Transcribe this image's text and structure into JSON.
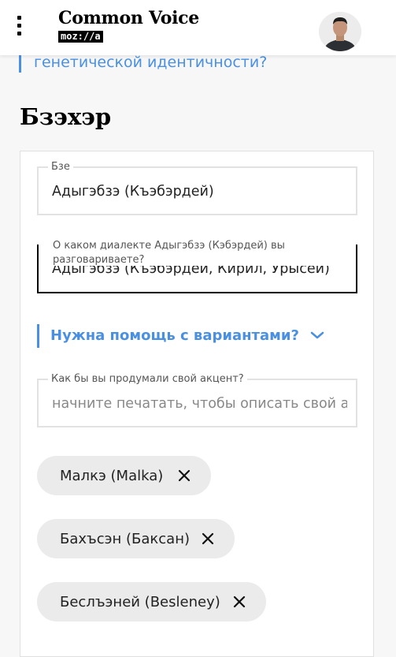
{
  "header": {
    "brand_title": "Common Voice",
    "brand_sub": "moz://a",
    "icons": {
      "menu": "menu-icon",
      "avatar": "user-avatar"
    }
  },
  "previous_field_text": "генетической идентичности?",
  "section_title": "Бзэхэр",
  "language_field": {
    "label": "Бзе",
    "value": "Адыгэбзэ (Къэбэрдей)"
  },
  "dialect_field": {
    "label": "О каком диалекте Адыгэбзэ (Кэбэрдей) вы разговариваете?",
    "value": "Адыгэбзэ (Къэбэрдей, Кирил, Урысей)"
  },
  "help_link": {
    "label": "Нужна помощь с вариантами?",
    "icon": "chevron-down-icon"
  },
  "accent_field": {
    "label": "Как бы вы продумали свой акцент?",
    "placeholder": "начните печатать, чтобы описать свой акцент"
  },
  "accent_tags": [
    {
      "label": "Малкэ (Malka)"
    },
    {
      "label": "Бахъсэн (Баксан)"
    },
    {
      "label": "Беслъэней (Besleney)"
    }
  ],
  "colors": {
    "accent": "#4a90e2",
    "tag_bg": "#ebebeb"
  }
}
